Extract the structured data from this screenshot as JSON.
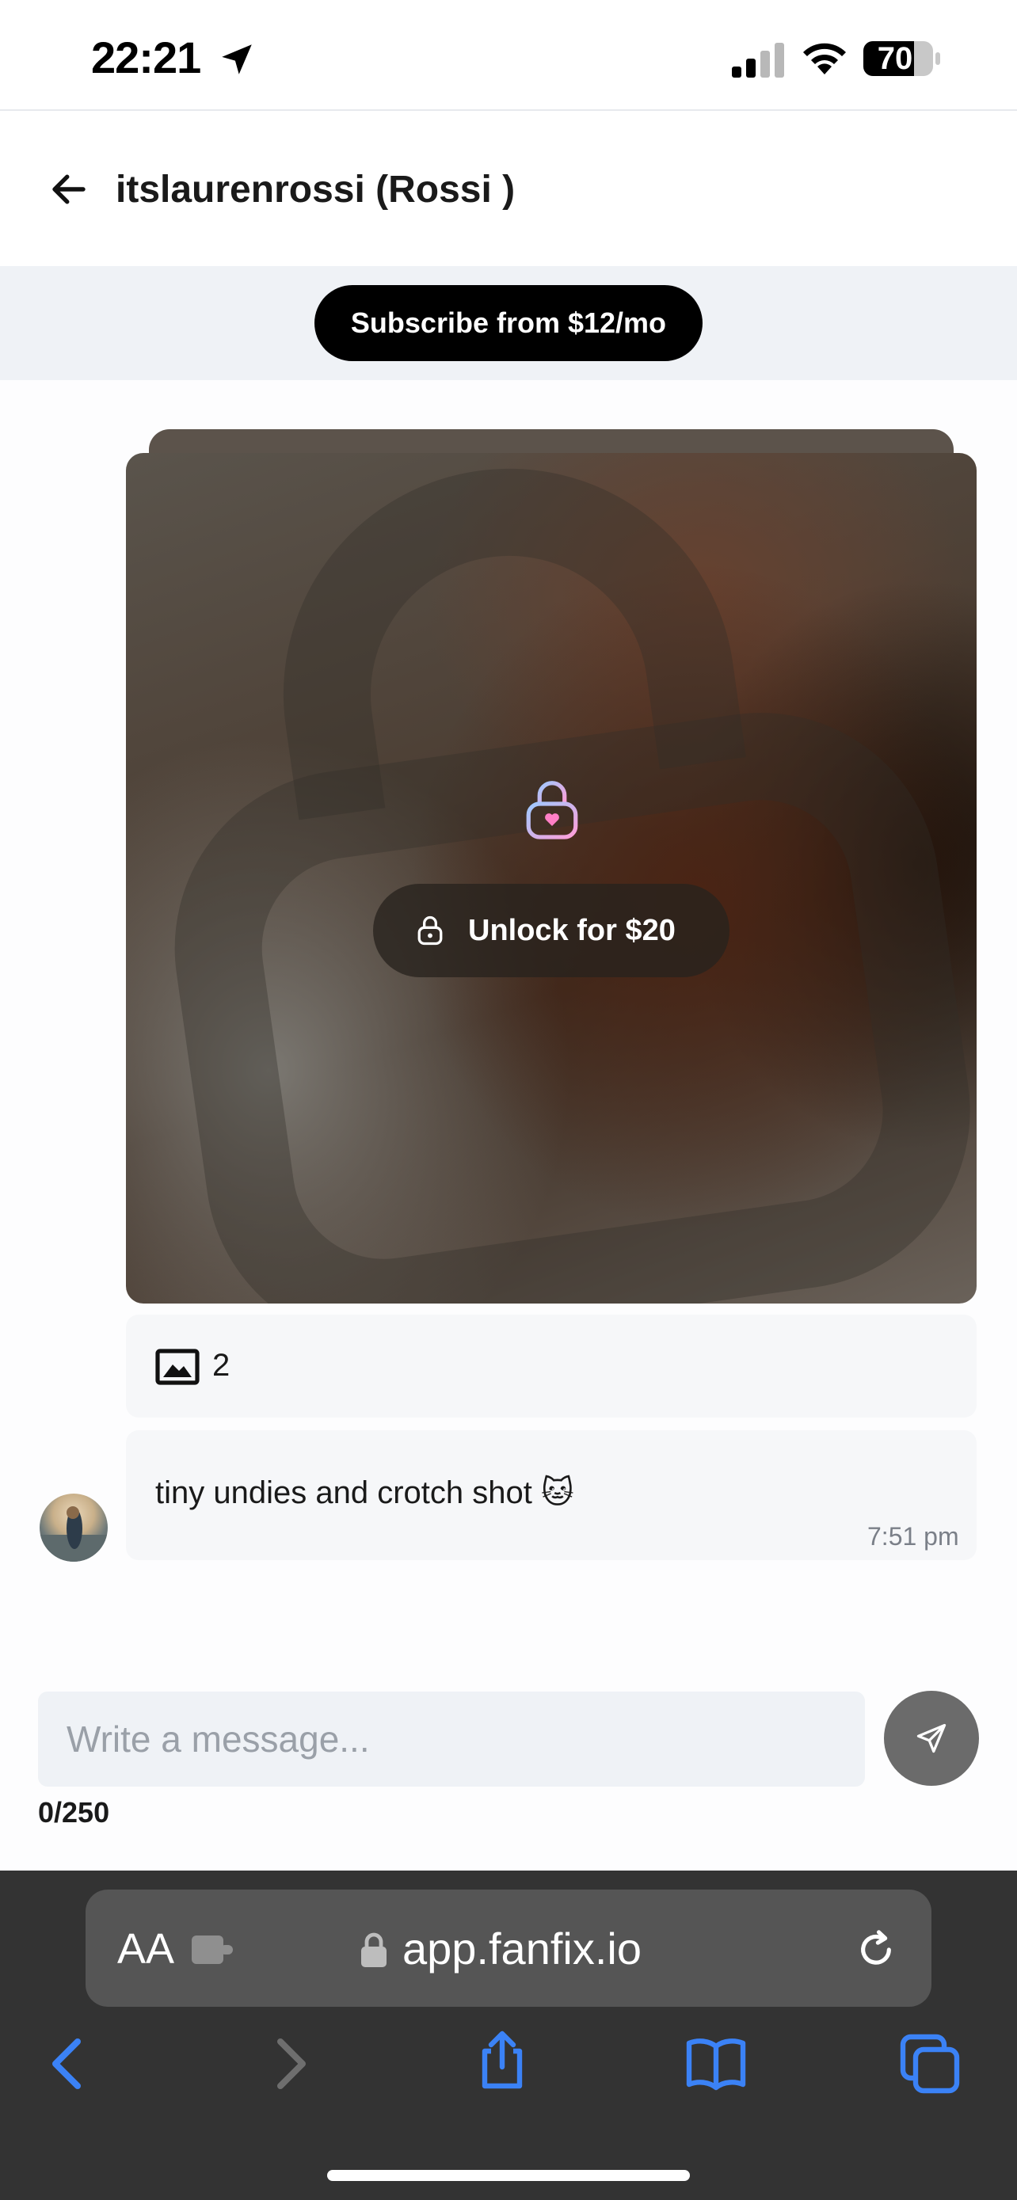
{
  "status_bar": {
    "time": "22:21",
    "battery": "70",
    "icons": [
      "location-arrow-icon",
      "signal-icon",
      "wifi-icon",
      "battery-icon"
    ]
  },
  "header": {
    "title": "itslaurenrossi (Rossi )",
    "back_icon": "arrow-left-icon"
  },
  "subscribe": {
    "label": "Subscribe from $12/mo"
  },
  "locked_post": {
    "unlock_label": "Unlock for $20",
    "lock_icon": "lock-heart-icon",
    "media_count": "2",
    "media_icon": "image-icon"
  },
  "message": {
    "text": "tiny undies and crotch shot 🐱",
    "time": "7:51 pm"
  },
  "composer": {
    "placeholder": "Write a message...",
    "char_count": "0/250",
    "send_icon": "send-icon"
  },
  "browser": {
    "text_size_label": "AA",
    "url": "app.fanfix.io",
    "icons": [
      "extension-icon",
      "lock-icon",
      "reload-icon",
      "back-icon",
      "forward-icon",
      "share-icon",
      "bookmarks-icon",
      "tabs-icon"
    ]
  },
  "colors": {
    "accent_blue": "#3b82f6",
    "subscribe_bg": "#000000",
    "band_bg": "#eff2f6"
  }
}
